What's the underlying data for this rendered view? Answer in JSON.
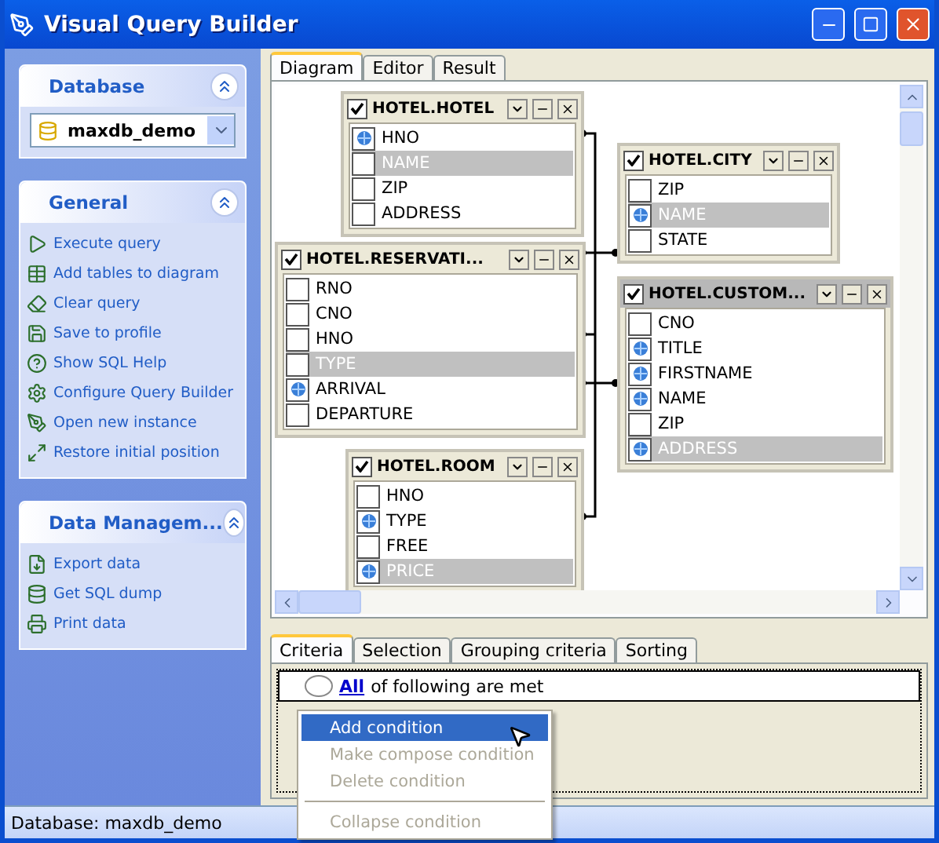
{
  "window": {
    "title": "Visual Query Builder"
  },
  "sidebar": {
    "groups": [
      {
        "title": "Database",
        "expanded": true,
        "kind": "combo",
        "value": "maxdb_demo"
      },
      {
        "title": "General",
        "expanded": true,
        "kind": "links",
        "items": [
          "Execute query",
          "Add tables to diagram",
          "Clear query",
          "Save to profile",
          "Show SQL Help",
          "Configure Query Builder",
          "Open new instance",
          "Restore initial position"
        ]
      },
      {
        "title": "Data Managem...",
        "expanded": true,
        "kind": "links",
        "items": [
          "Export data",
          "Get SQL dump",
          "Print data"
        ]
      }
    ]
  },
  "tabs": [
    {
      "label": "Diagram",
      "selected": true
    },
    {
      "label": "Editor",
      "selected": false
    },
    {
      "label": "Result",
      "selected": false
    }
  ],
  "tables": [
    {
      "name": "HOTEL.HOTEL",
      "checked": true,
      "selected": false,
      "fields": [
        {
          "name": "HNO",
          "output": true,
          "highlighted": false
        },
        {
          "name": "NAME",
          "output": false,
          "highlighted": true
        },
        {
          "name": "ZIP",
          "output": false,
          "highlighted": false
        },
        {
          "name": "ADDRESS",
          "output": false,
          "highlighted": false
        }
      ]
    },
    {
      "name": "HOTEL.CITY",
      "checked": true,
      "selected": false,
      "fields": [
        {
          "name": "ZIP",
          "output": false,
          "highlighted": false
        },
        {
          "name": "NAME",
          "output": true,
          "highlighted": true
        },
        {
          "name": "STATE",
          "output": false,
          "highlighted": false
        }
      ]
    },
    {
      "name": "HOTEL.RESERVATI...",
      "checked": true,
      "selected": false,
      "fields": [
        {
          "name": "RNO",
          "output": false,
          "highlighted": false
        },
        {
          "name": "CNO",
          "output": false,
          "highlighted": false
        },
        {
          "name": "HNO",
          "output": false,
          "highlighted": false
        },
        {
          "name": "TYPE",
          "output": false,
          "highlighted": true
        },
        {
          "name": "ARRIVAL",
          "output": true,
          "highlighted": false
        },
        {
          "name": "DEPARTURE",
          "output": false,
          "highlighted": false
        }
      ]
    },
    {
      "name": "HOTEL.CUSTOM...",
      "checked": true,
      "selected": true,
      "fields": [
        {
          "name": "CNO",
          "output": false,
          "highlighted": false
        },
        {
          "name": "TITLE",
          "output": true,
          "highlighted": false
        },
        {
          "name": "FIRSTNAME",
          "output": true,
          "highlighted": false
        },
        {
          "name": "NAME",
          "output": true,
          "highlighted": false
        },
        {
          "name": "ZIP",
          "output": false,
          "highlighted": false
        },
        {
          "name": "ADDRESS",
          "output": true,
          "highlighted": true
        }
      ]
    },
    {
      "name": "HOTEL.ROOM",
      "checked": true,
      "selected": false,
      "fields": [
        {
          "name": "HNO",
          "output": false,
          "highlighted": false
        },
        {
          "name": "TYPE",
          "output": true,
          "highlighted": false
        },
        {
          "name": "FREE",
          "output": false,
          "highlighted": false
        },
        {
          "name": "PRICE",
          "output": true,
          "highlighted": true
        }
      ]
    }
  ],
  "bottom_tabs": [
    {
      "label": "Criteria",
      "selected": true
    },
    {
      "label": "Selection",
      "selected": false
    },
    {
      "label": "Grouping criteria",
      "selected": false
    },
    {
      "label": "Sorting",
      "selected": false
    }
  ],
  "criteria": {
    "link": "All",
    "text": "of following are met"
  },
  "context_menu": [
    {
      "kind": "item",
      "label": "Add condition",
      "selected": true,
      "disabled": false
    },
    {
      "kind": "item",
      "label": "Make compose condition",
      "selected": false,
      "disabled": true
    },
    {
      "kind": "item",
      "label": "Delete condition",
      "selected": false,
      "disabled": true
    },
    {
      "kind": "separator"
    },
    {
      "kind": "item",
      "label": "Collapse condition",
      "selected": false,
      "disabled": true
    }
  ],
  "status_bar": {
    "text": "Database: maxdb_demo"
  }
}
